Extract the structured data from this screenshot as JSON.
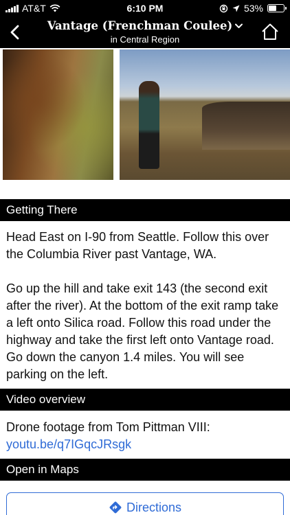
{
  "status_bar": {
    "carrier": "AT&T",
    "time": "6:10 PM",
    "battery_percent": "53%",
    "battery_level": 0.53,
    "icons": [
      "signal-icon",
      "wifi-icon",
      "rotation-lock-icon",
      "location-arrow-icon",
      "battery-icon"
    ]
  },
  "nav": {
    "title": "Vantage (Frenchman Coulee)",
    "subtitle": "in Central Region",
    "icons": [
      "back-chevron-icon",
      "chevron-down-icon",
      "home-icon"
    ]
  },
  "photos": [
    "climber-photo",
    "person-at-canyon-photo"
  ],
  "getting_there": {
    "header": "Getting There",
    "paragraphs": [
      "Head East on I-90 from Seattle. Follow this over the Columbia River past Vantage, WA.",
      "Go up the hill and take exit 143 (the second exit after the river). At the bottom of the exit ramp take a left onto Silica road. Follow this road under the highway and take the first left onto Vantage road. Go down the canyon 1.4 miles. You will see parking on the left."
    ]
  },
  "video": {
    "header": "Video overview",
    "text": "Drone footage from Tom Pittman VIII:",
    "link": "youtu.be/q7IGqcJRsgk"
  },
  "maps": {
    "header": "Open in Maps",
    "directions_label": "Directions",
    "icon": "directions-diamond-icon"
  },
  "colors": {
    "bar_background": "#000000",
    "link": "#2f6bd6"
  }
}
